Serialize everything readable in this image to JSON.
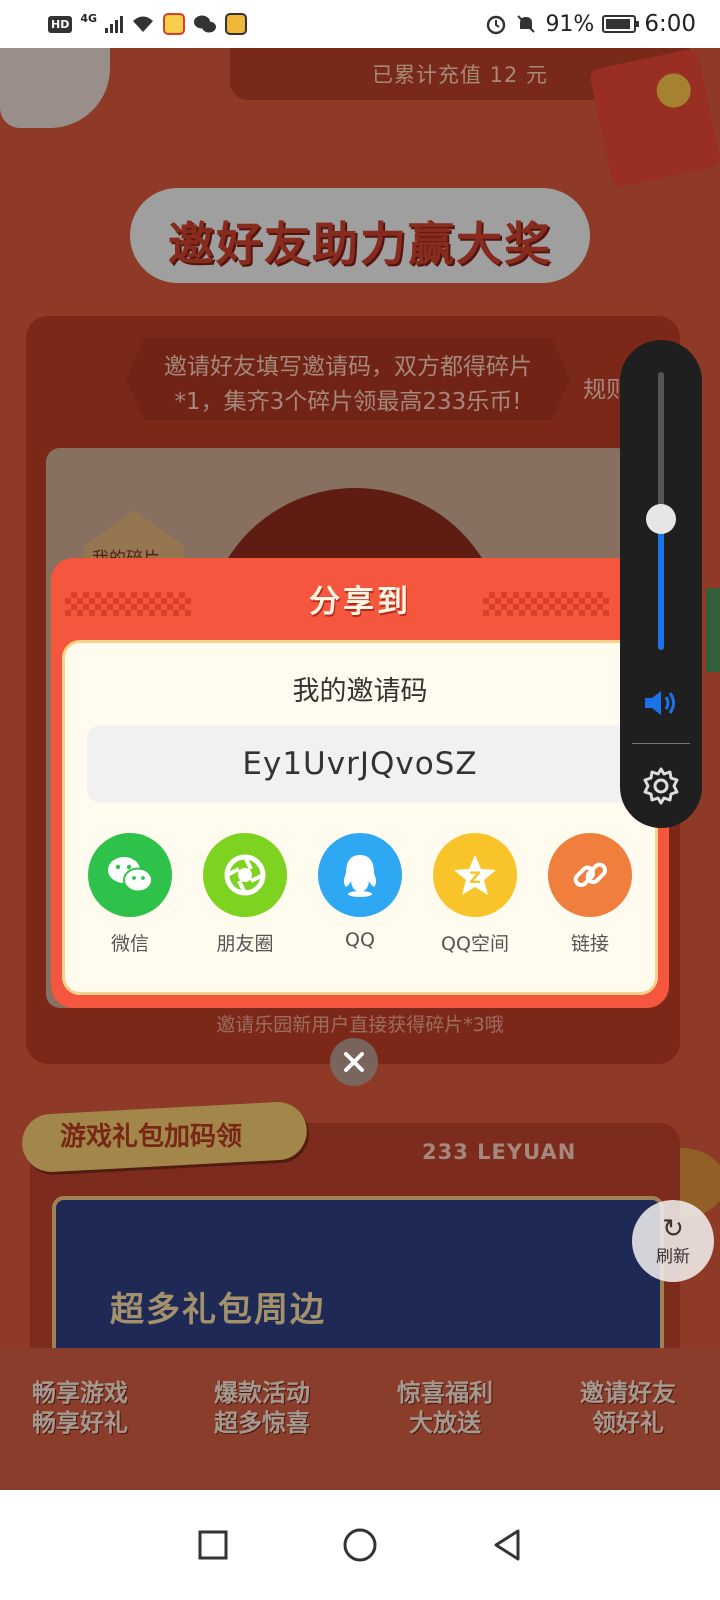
{
  "status_bar": {
    "hd": "HD",
    "network": "4G",
    "battery": "91%",
    "time": "6:00"
  },
  "background": {
    "recharge_text": "已累计充值 12 元",
    "section_title": "邀好友助力赢大奖",
    "invite_desc": "邀请好友填写邀请码，双方都得碎片*1，集齐3个碎片领最高233乐币!",
    "rules": "规则",
    "fragment_tag": "我的碎片",
    "footer_note": "邀请乐园新用户直接获得碎片*3哦",
    "gift_title": "游戏礼包加码领",
    "leyuan_label": "233 LEYUAN",
    "gift_banner_text": "超多礼包周边",
    "features": [
      {
        "line1": "畅享游戏",
        "line2": "畅享好礼"
      },
      {
        "line1": "爆款活动",
        "line2": "超多惊喜"
      },
      {
        "line1": "惊喜福利",
        "line2": "大放送"
      },
      {
        "line1": "邀请好友",
        "line2": "领好礼"
      }
    ],
    "refresh_label": "刷新"
  },
  "dialog": {
    "title": "分享到",
    "label": "我的邀请码",
    "invite_code": "Ey1UvrJQvoSZ",
    "share_targets": [
      {
        "label": "微信",
        "icon": "wechat-icon",
        "color": "#2ec24a"
      },
      {
        "label": "朋友圈",
        "icon": "moments-icon",
        "color": "#7ed321"
      },
      {
        "label": "QQ",
        "icon": "qq-icon",
        "color": "#2ea8f2"
      },
      {
        "label": "QQ空间",
        "icon": "qzone-icon",
        "color": "#f8c42a"
      },
      {
        "label": "链接",
        "icon": "link-icon",
        "color": "#f07e3c"
      }
    ]
  },
  "volume": {
    "level": 0.47,
    "accent": "#1a73e8"
  }
}
